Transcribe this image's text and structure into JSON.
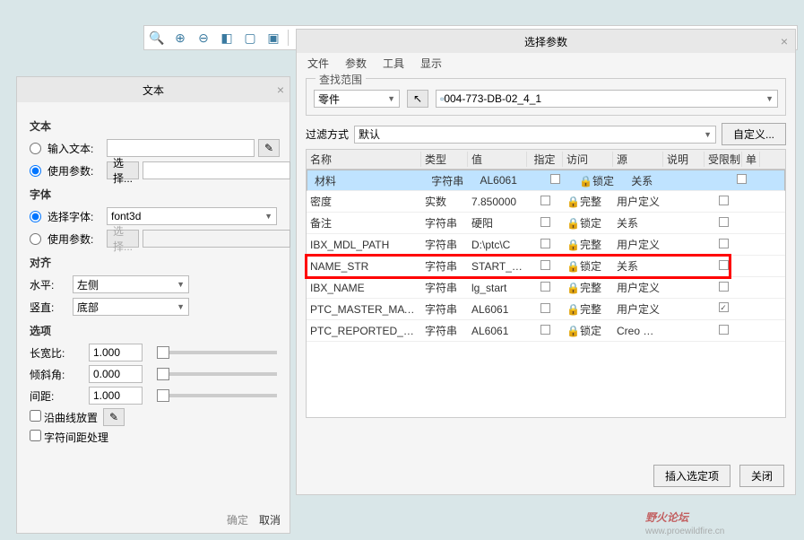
{
  "toolbar": {
    "icons": [
      "search",
      "zoom-in",
      "zoom-out",
      "fit",
      "box",
      "box2",
      "t1",
      "t2",
      "t3",
      "t4",
      "t5",
      "t6",
      "t7",
      "t8",
      "t9",
      "t10",
      "t11",
      "t12"
    ]
  },
  "textDlg": {
    "title": "文本",
    "sec_text": "文本",
    "input_text": "输入文本:",
    "use_param": "使用参数:",
    "select_btn": "选择...",
    "sec_font": "字体",
    "select_font": "选择字体:",
    "font_value": "font3d",
    "use_param2": "使用参数:",
    "select_ph": "选择...",
    "sec_align": "对齐",
    "h_label": "水平:",
    "h_value": "左侧",
    "v_label": "竖直:",
    "v_value": "底部",
    "sec_opt": "选项",
    "aspect": "长宽比:",
    "aspect_v": "1.000",
    "angle": "倾斜角:",
    "angle_v": "0.000",
    "spacing": "间距:",
    "spacing_v": "1.000",
    "along_curve": "沿曲线放置",
    "char_space": "字符间距处理",
    "ok": "确定",
    "cancel": "取消"
  },
  "paramDlg": {
    "title": "选择参数",
    "menu": [
      "文件",
      "参数",
      "工具",
      "显示"
    ],
    "find_label": "查找范围",
    "scope": "零件",
    "scope_path": "004-773-DB-02_4_1",
    "filter_label": "过滤方式",
    "filter_value": "默认",
    "custom_btn": "自定义...",
    "headers": [
      "名称",
      "类型",
      "值",
      "指定",
      "访问",
      "源",
      "说明",
      "受限制",
      "单"
    ],
    "rows": [
      {
        "name": "材料",
        "type": "字符串",
        "val": "AL6061",
        "spec": 0,
        "acc": "锁定",
        "src": "关系",
        "desc": "",
        "lim": 0,
        "sel": true
      },
      {
        "name": "密度",
        "type": "实数",
        "val": "7.850000",
        "spec": 0,
        "acc": "完整",
        "src": "用户定义",
        "desc": "",
        "lim": 0
      },
      {
        "name": "备注",
        "type": "字符串",
        "val": "硬阳",
        "spec": 0,
        "acc": "锁定",
        "src": "关系",
        "desc": "",
        "lim": 0
      },
      {
        "name": "IBX_MDL_PATH",
        "type": "字符串",
        "val": "D:\\ptc\\C",
        "spec": 0,
        "acc": "完整",
        "src": "用户定义",
        "desc": "",
        "lim": 0
      },
      {
        "name": "NAME_STR",
        "type": "字符串",
        "val": "START_PA",
        "spec": 0,
        "acc": "锁定",
        "src": "关系",
        "desc": "",
        "lim": 0,
        "hl": true
      },
      {
        "name": "IBX_NAME",
        "type": "字符串",
        "val": "lg_start",
        "spec": 0,
        "acc": "完整",
        "src": "用户定义",
        "desc": "",
        "lim": 0
      },
      {
        "name": "PTC_MASTER_MATERIAL",
        "type": "字符串",
        "val": "AL6061",
        "spec": 0,
        "acc": "完整",
        "src": "用户定义",
        "desc": "",
        "lim": 1
      },
      {
        "name": "PTC_REPORTED_MATERIAL",
        "type": "字符串",
        "val": "AL6061",
        "spec": 0,
        "acc": "锁定",
        "src": "Creo Par",
        "desc": "",
        "lim": 0
      }
    ],
    "insert_btn": "插入选定项",
    "close_btn": "关闭"
  },
  "watermark": {
    "brand": "野火论坛",
    "url": "www.proewildfire.cn"
  }
}
